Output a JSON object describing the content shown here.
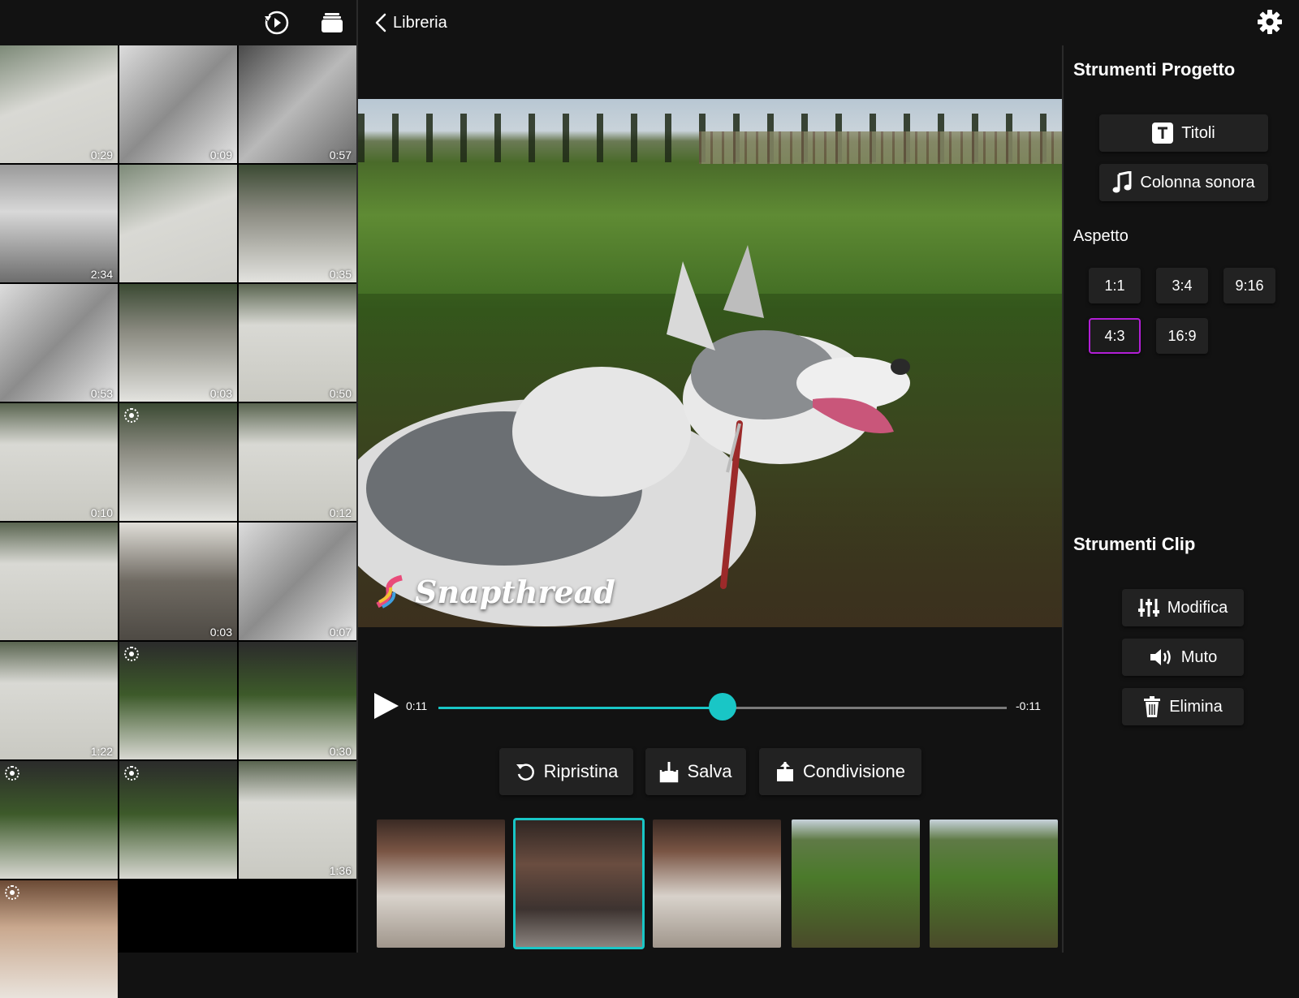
{
  "left_panel": {
    "icons": [
      "history-icon",
      "stack-icon"
    ],
    "thumbnails": [
      {
        "duration": "0:29",
        "live": false,
        "tone": "snow-dog"
      },
      {
        "duration": "0:09",
        "live": false,
        "tone": "blur"
      },
      {
        "duration": "0:57",
        "live": false,
        "tone": "blur-dark"
      },
      {
        "duration": "2:34",
        "live": false,
        "tone": "grey"
      },
      {
        "duration": "",
        "live": false,
        "tone": "snow-dog"
      },
      {
        "duration": "0:35",
        "live": false,
        "tone": "garden"
      },
      {
        "duration": "0:53",
        "live": false,
        "tone": "blur"
      },
      {
        "duration": "0:03",
        "live": false,
        "tone": "garden"
      },
      {
        "duration": "0:50",
        "live": false,
        "tone": "snow"
      },
      {
        "duration": "0:10",
        "live": false,
        "tone": "snow"
      },
      {
        "duration": "",
        "live": true,
        "tone": "garden"
      },
      {
        "duration": "0:12",
        "live": false,
        "tone": "snow"
      },
      {
        "duration": "",
        "live": false,
        "tone": "snow"
      },
      {
        "duration": "0:03",
        "live": false,
        "tone": "porch"
      },
      {
        "duration": "0:07",
        "live": false,
        "tone": "blur"
      },
      {
        "duration": "1:22",
        "live": false,
        "tone": "snow"
      },
      {
        "duration": "",
        "live": true,
        "tone": "fence"
      },
      {
        "duration": "0:30",
        "live": false,
        "tone": "fence"
      },
      {
        "duration": "",
        "live": true,
        "tone": "fence"
      },
      {
        "duration": "",
        "live": true,
        "tone": "fence"
      },
      {
        "duration": "1:36",
        "live": false,
        "tone": "snow"
      },
      {
        "duration": "",
        "live": true,
        "tone": "room"
      }
    ]
  },
  "header": {
    "back_label": "Libreria",
    "settings_icon": "gear-icon"
  },
  "player": {
    "watermark": "Snapthread",
    "elapsed": "0:11",
    "remaining": "-0:11",
    "progress": 0.5
  },
  "actions": {
    "reset": "Ripristina",
    "save": "Salva",
    "share": "Condivisione"
  },
  "filmstrip": {
    "clips": [
      {
        "tone": "dog-indoor",
        "selected": false
      },
      {
        "tone": "dog-indoor-close",
        "selected": true
      },
      {
        "tone": "dog-indoor",
        "selected": false
      },
      {
        "tone": "dog-field",
        "selected": false
      },
      {
        "tone": "dog-field",
        "selected": false
      }
    ]
  },
  "project_tools": {
    "title": "Strumenti Progetto",
    "titles_button": "Titoli",
    "soundtrack_button": "Colonna sonora",
    "aspect_label": "Aspetto",
    "aspects": [
      "1:1",
      "3:4",
      "9:16",
      "4:3",
      "16:9"
    ],
    "selected_aspect": "4:3"
  },
  "clip_tools": {
    "title": "Strumenti Clip",
    "edit_button": "Modifica",
    "mute_button": "Muto",
    "delete_button": "Elimina"
  },
  "colors": {
    "accent": "#19c6c6",
    "selection": "#b21fd6",
    "background": "#121212"
  }
}
